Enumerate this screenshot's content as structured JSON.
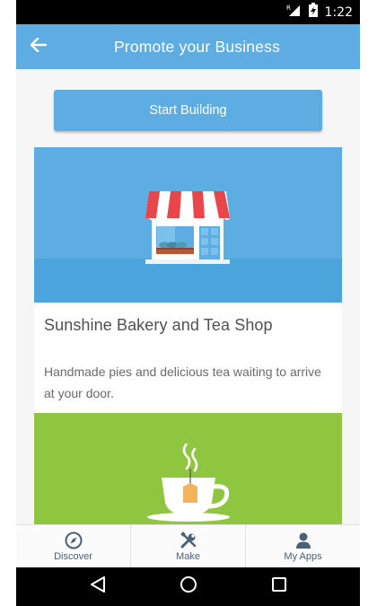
{
  "status_bar": {
    "time": "1:22",
    "signal_label": "R"
  },
  "app_bar": {
    "title": "Promote your Business",
    "back_icon": "arrow-left-icon"
  },
  "primary_action": {
    "label": "Start Building"
  },
  "cards": [
    {
      "title": "Sunshine Bakery and Tea Shop",
      "description": "Handmade pies and delicious tea waiting to arrive at your door.",
      "illustration": "storefront-icon"
    },
    {
      "illustration": "tea-cup-icon"
    }
  ],
  "bottom_nav": {
    "items": [
      {
        "label": "Discover",
        "icon": "compass-icon"
      },
      {
        "label": "Make",
        "icon": "tools-icon"
      },
      {
        "label": "My Apps",
        "icon": "person-icon"
      }
    ]
  },
  "colors": {
    "primary": "#5dade2",
    "card_green": "#8fc63f",
    "awning_red": "#e8464b",
    "nav_text": "#4a6076"
  }
}
